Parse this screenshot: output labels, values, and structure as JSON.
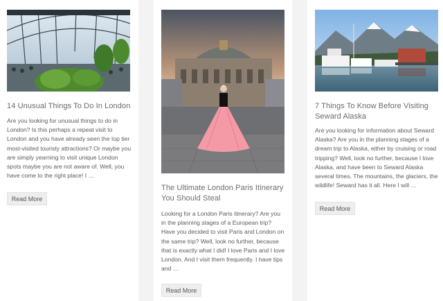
{
  "posts": [
    {
      "image_alt": "Sky Garden conservatory interior",
      "title": "14 Unusual Things To Do In London",
      "excerpt": "Are you looking for unusual things to do in London? Is this perhaps a repeat visit to London and you have already seen the top tier most-visited touristy attractions? Or maybe you are simply yearning to visit unique London spots maybe you are not aware of. Well,  you have come to the right place! I …",
      "read_more": "Read More"
    },
    {
      "image_alt": "Woman in pink skirt on rooftop in front of Palais Garnier",
      "title": "The Ultimate London Paris Itinerary You Should Steal",
      "excerpt": "Looking for a London Paris itinerary?  Are you in the planning stages of a European trip? Have you decided to visit Paris and London on the same trip? Well, look no further, because that is exactly what I did! I love Paris and I love London. And I visit them frequently. I have tips and …",
      "read_more": "Read More"
    },
    {
      "image_alt": "Seward Alaska harbor with boats and mountains",
      "title": "7 Things To Know Before Visiting Seward Alaska",
      "excerpt": "Are you looking for information about Seward Alaska? Are you in the planning stages of a dream trip to Alaska, either by cruising or road tripping? Well, look no further, because I love Alaska, and have been to Seward Alaska several times. The mountains, the glaciers, the wildlife! Seward has it all. Here I will …",
      "read_more": "Read More"
    }
  ],
  "colors": {
    "background": "#f3f3f3",
    "card": "#ffffff",
    "title": "#6a6a6a",
    "text": "#5a5a5a",
    "button_bg": "#eeeeee"
  }
}
